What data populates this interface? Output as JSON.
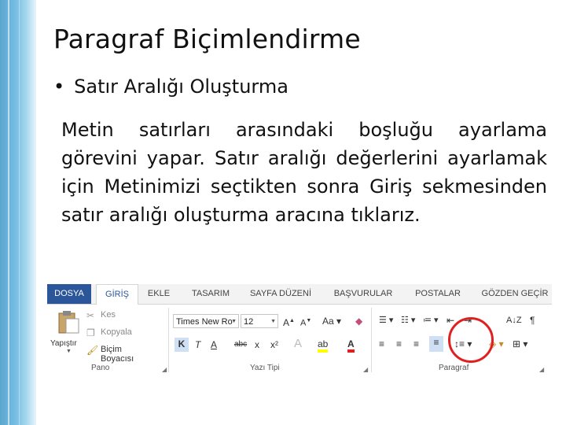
{
  "slide": {
    "title": "Paragraf Biçimlendirme",
    "bullet": "Satır Aralığı Oluşturma",
    "body": "Metin satırları arasındaki boşluğu ayarlama görevini yapar. Satır aralığı değerlerini ayarlamak için Metinimizi seçtikten sonra Giriş sekmesinden  satır aralığı oluşturma aracına tıklarız."
  },
  "ribbon": {
    "tabs": [
      "DOSYA",
      "GİRİŞ",
      "EKLE",
      "TASARIM",
      "SAYFA DÜZENİ",
      "BAŞVURULAR",
      "POSTALAR",
      "GÖZDEN GEÇİR"
    ],
    "clipboard": {
      "paste": "Yapıştır",
      "cut": "Kes",
      "copy": "Kopyala",
      "format_painter": "Biçim Boyacısı",
      "label": "Pano"
    },
    "font": {
      "name": "Times New Ro",
      "size": "12",
      "bold": "K",
      "italic": "T",
      "underline": "A",
      "strike": "abc",
      "subscript": "x",
      "superscript": "x²",
      "label": "Yazı Tipi"
    },
    "paragraph": {
      "label": "Paragraf"
    }
  },
  "colors": {
    "file_tab": "#2b579a",
    "highlight_circle": "#e02020",
    "font_color": "#e02020",
    "highlight_color": "#ffff00"
  }
}
